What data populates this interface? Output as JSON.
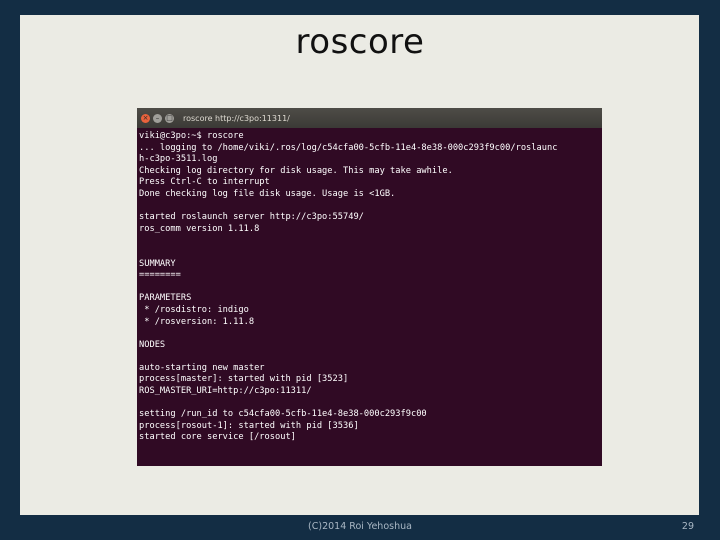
{
  "slide": {
    "title": "roscore",
    "footer": "(C)2014 Roi Yehoshua",
    "page_number": "29"
  },
  "terminal": {
    "window_title": "roscore http://c3po:11311/",
    "close_glyph": "×",
    "minimize_glyph": "–",
    "maximize_glyph": "□",
    "lines": [
      "viki@c3po:~$ roscore",
      "... logging to /home/viki/.ros/log/c54cfa00-5cfb-11e4-8e38-000c293f9c00/roslaunc",
      "h-c3po-3511.log",
      "Checking log directory for disk usage. This may take awhile.",
      "Press Ctrl-C to interrupt",
      "Done checking log file disk usage. Usage is <1GB.",
      "",
      "started roslaunch server http://c3po:55749/",
      "ros_comm version 1.11.8",
      "",
      "",
      "SUMMARY",
      "========",
      "",
      "PARAMETERS",
      " * /rosdistro: indigo",
      " * /rosversion: 1.11.8",
      "",
      "NODES",
      "",
      "auto-starting new master",
      "process[master]: started with pid [3523]",
      "ROS_MASTER_URI=http://c3po:11311/",
      "",
      "setting /run_id to c54cfa00-5cfb-11e4-8e38-000c293f9c00",
      "process[rosout-1]: started with pid [3536]",
      "started core service [/rosout]"
    ]
  },
  "colors": {
    "background": "#132d44",
    "slide_panel": "#ebebe4",
    "terminal_bg": "#300a24",
    "terminal_text": "#ffffff",
    "close_button": "#e9623c"
  }
}
